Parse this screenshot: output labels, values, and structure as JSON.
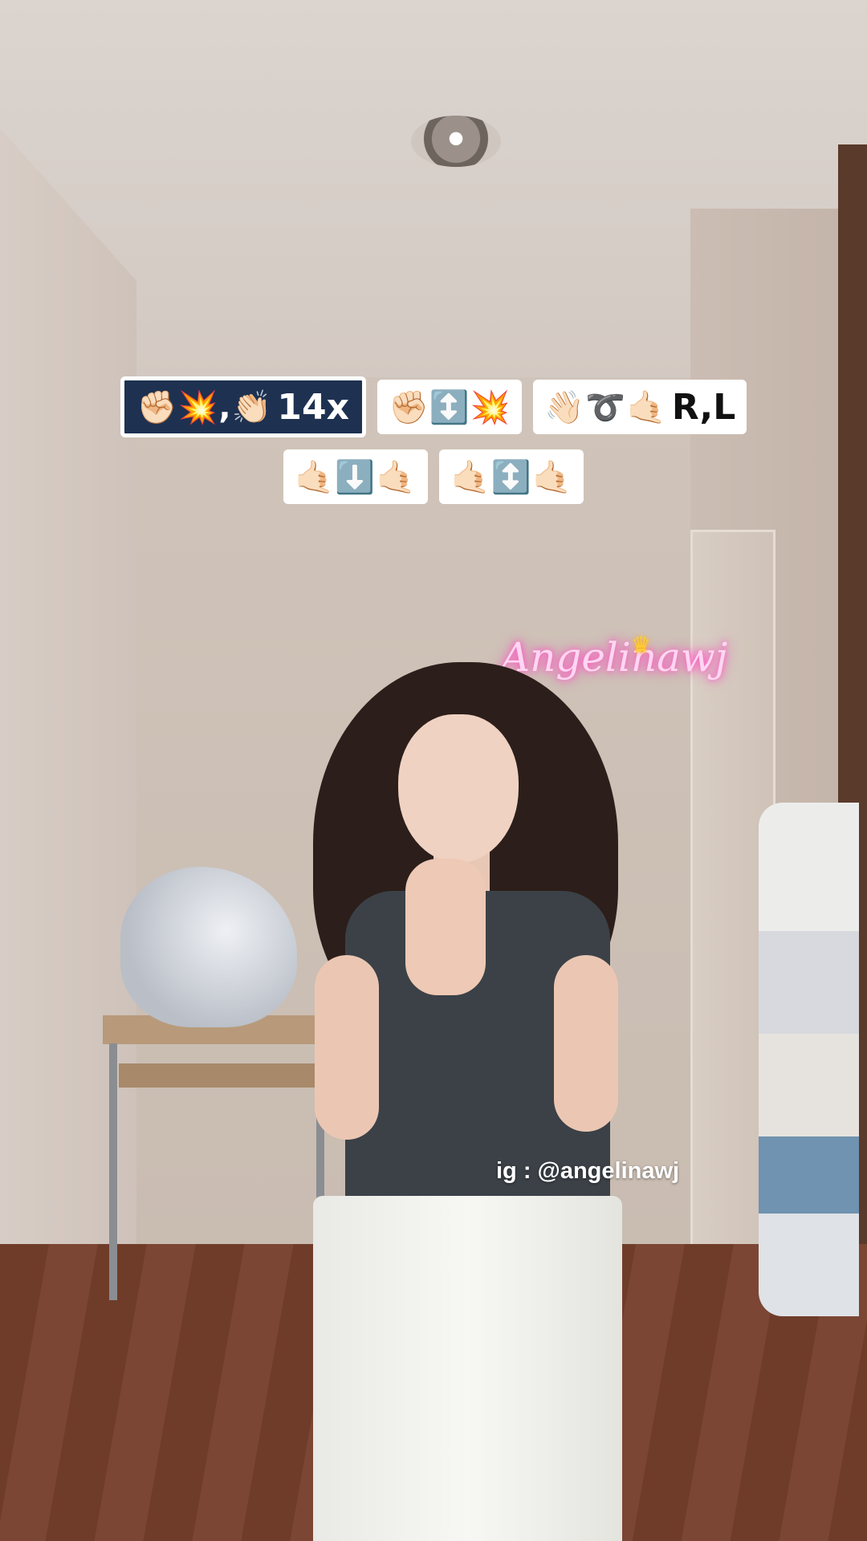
{
  "overlay": {
    "chips_row1": [
      {
        "emoji": "✊🏻💥,👏🏻",
        "text": "14x",
        "style": "dark"
      },
      {
        "emoji": "✊🏻↕️💥",
        "text": "",
        "style": "light"
      },
      {
        "emoji": "👋🏻➰🤙🏻",
        "text": "R,L",
        "style": "light"
      }
    ],
    "chips_row2": [
      {
        "emoji": "🤙🏻⬇️🤙🏻",
        "text": "",
        "style": "light"
      },
      {
        "emoji": "🤙🏻↕️🤙🏻",
        "text": "",
        "style": "light"
      }
    ],
    "handle": "ig : @angelinawj"
  },
  "scene": {
    "neon_sign": "Angelinawj",
    "neon_color": "#ff5cc8",
    "chip_dark_color": "#1e3151",
    "chip_light_color": "#ffffff"
  }
}
